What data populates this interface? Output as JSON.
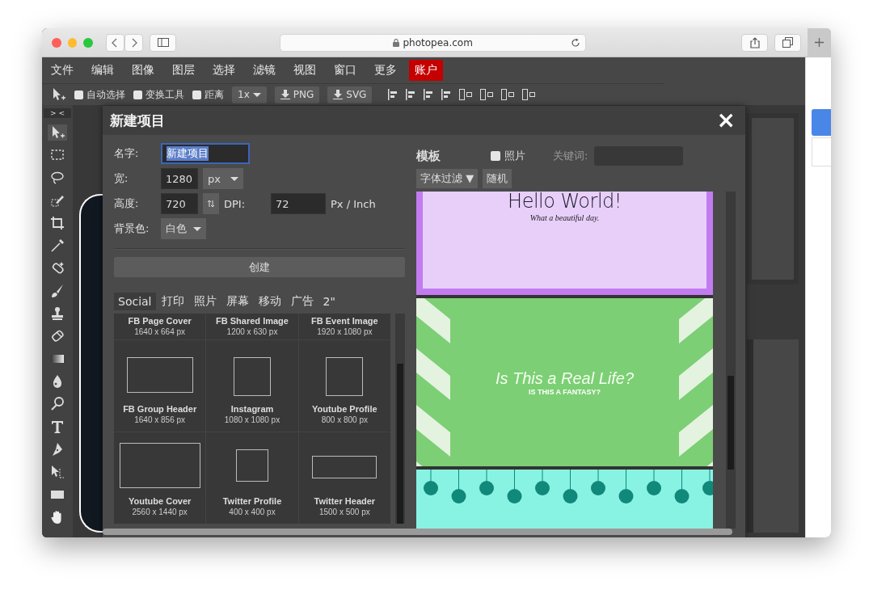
{
  "browser": {
    "url": "photopea.com"
  },
  "menu": [
    {
      "label": "文件",
      "selected": false
    },
    {
      "label": "编辑",
      "selected": false
    },
    {
      "label": "图像",
      "selected": false
    },
    {
      "label": "图层",
      "selected": false
    },
    {
      "label": "选择",
      "selected": false
    },
    {
      "label": "滤镜",
      "selected": false
    },
    {
      "label": "视图",
      "selected": false
    },
    {
      "label": "窗口",
      "selected": false
    },
    {
      "label": "更多",
      "selected": false
    },
    {
      "label": "账户",
      "selected": true
    }
  ],
  "toolbar": [
    {
      "kind": "checkbox",
      "label": "自动选择",
      "checked": false
    },
    {
      "kind": "checkbox",
      "label": "变换工具",
      "checked": false
    },
    {
      "kind": "checkbox",
      "label": "距离",
      "checked": false
    },
    {
      "kind": "dropdown",
      "label": "1x"
    },
    {
      "kind": "export",
      "label": "PNG"
    },
    {
      "kind": "export",
      "label": "SVG"
    }
  ],
  "toolbox": {
    "collapse": "> <"
  },
  "dialog": {
    "title": "新建项目",
    "close": "×",
    "form": {
      "name_label": "名字:",
      "name_value": "新建项目",
      "name_selected": true,
      "width_label": "宽:",
      "width_value": "1280",
      "unit": "px",
      "height_label": "高度:",
      "height_value": "720",
      "dpi_label": "DPI:",
      "dpi_value": "72",
      "dpi_unit": "Px / Inch",
      "background_label": "背景色:",
      "background_value": "白色",
      "create": "创建"
    },
    "tabs": [
      {
        "label": "Social",
        "selected": true
      },
      {
        "label": "打印",
        "selected": false
      },
      {
        "label": "照片",
        "selected": false
      },
      {
        "label": "屏幕",
        "selected": false
      },
      {
        "label": "移动",
        "selected": false
      },
      {
        "label": "广告",
        "selected": false
      },
      {
        "label": "2\"",
        "selected": false
      }
    ],
    "presets": [
      {
        "kind": "cropped",
        "name": "FB Page Cover",
        "size": "1640 x 664 px"
      },
      {
        "kind": "cropped",
        "name": "FB Shared Image",
        "size": "1200 x 630 px"
      },
      {
        "kind": "cropped",
        "name": "FB Event Image",
        "size": "1920 x 1080 px"
      },
      {
        "kind": "landscape",
        "name": "FB Group Header",
        "size": "1640 x 856 px"
      },
      {
        "kind": "square",
        "name": "Instagram",
        "size": "1080 x 1080 px"
      },
      {
        "kind": "square",
        "name": "Youtube Profile",
        "size": "800 x 800 px"
      },
      {
        "kind": "wide",
        "name": "Youtube Cover",
        "size": "2560 x 1440 px"
      },
      {
        "kind": "small-square",
        "name": "Twitter Profile",
        "size": "400 x 400 px"
      },
      {
        "kind": "banner",
        "name": "Twitter Header",
        "size": "1500 x 500 px"
      }
    ],
    "templates": {
      "title": "模板",
      "photo_filter": {
        "label": "照片",
        "checked": false
      },
      "keyword_label": "关键词:",
      "font_filter": "字体过滤 ▼",
      "random": "随机",
      "items": [
        {
          "kind": "hello",
          "title": "Hello World!",
          "subtitle": "What a beautiful day."
        },
        {
          "kind": "fantasy",
          "title": "Is This a Real Life?",
          "subtitle": "IS THIS A FANTASY?"
        },
        {
          "kind": "ornaments"
        }
      ]
    }
  }
}
